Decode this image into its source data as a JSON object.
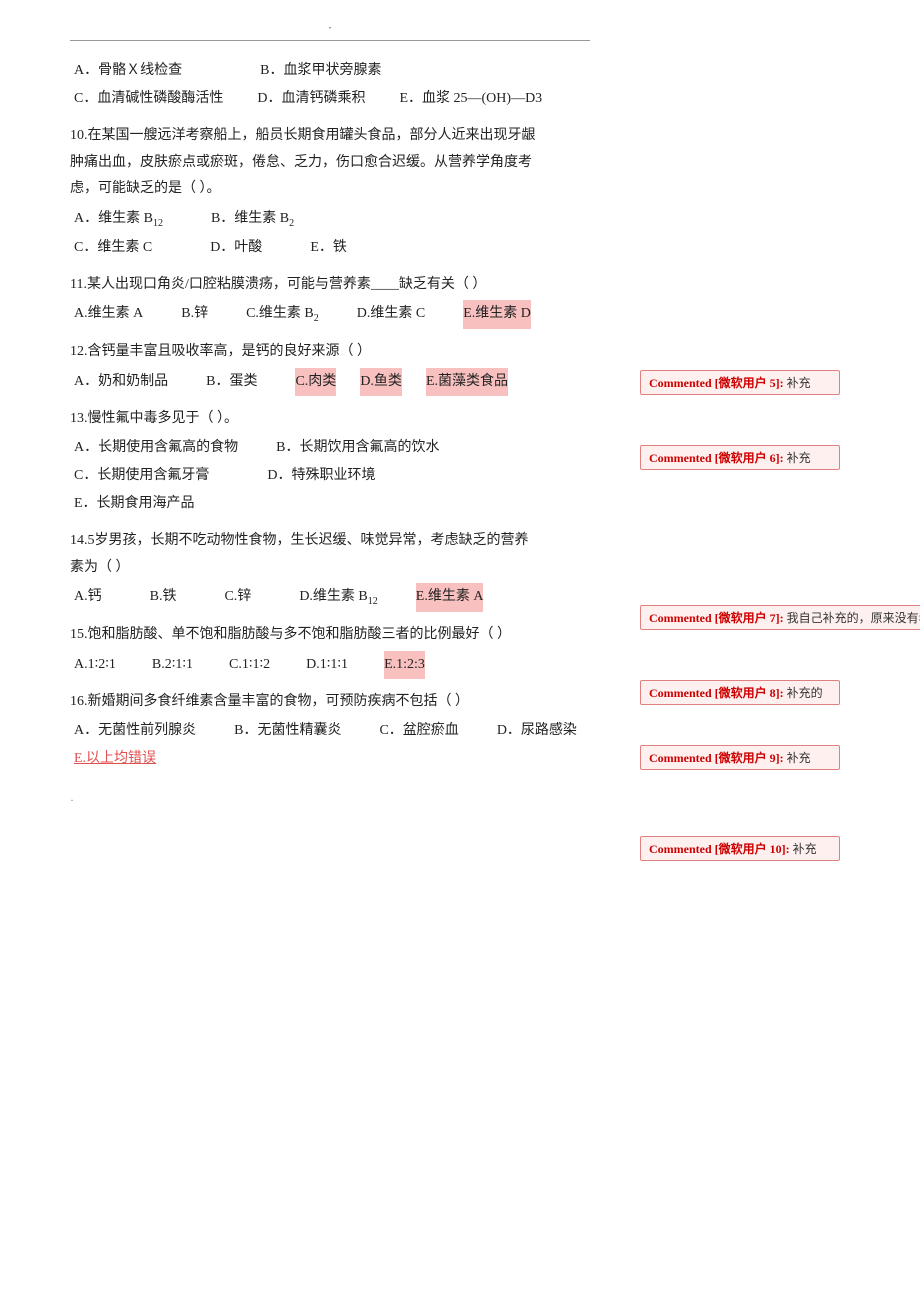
{
  "top": {
    "line_text": "·"
  },
  "questions": [
    {
      "id": "q_options_top",
      "options": [
        {
          "label": "A．骨骼Ｘ线检查",
          "highlight": false
        },
        {
          "label": "B．血浆甲状旁腺素",
          "highlight": false
        },
        {
          "label": "C．血清碱性磷酸酶活性",
          "highlight": false
        },
        {
          "label": "D．血清钙磷乘积",
          "highlight": false
        },
        {
          "label": "E．血浆 25—(OH)—D3",
          "highlight": false
        }
      ]
    },
    {
      "id": "q10",
      "num": "10",
      "text": "10.在某国一艘远洋考察船上，船员长期食用罐头食品，部分人近来出现牙龈肿痛出血，皮肤瘀点或瘀斑，倦怠、乏力，伤口愈合迟缓。从营养学角度考虑，可能缺乏的是（    ）。",
      "options": [
        {
          "label": "A．维生素 B₁₂",
          "highlight": false
        },
        {
          "label": "B．维生素 B₂",
          "highlight": false
        },
        {
          "label": "C．维生素 C",
          "highlight": false
        },
        {
          "label": "D．叶酸",
          "highlight": false
        },
        {
          "label": "E．铁",
          "highlight": false
        }
      ]
    },
    {
      "id": "q11",
      "num": "11",
      "text": "11.某人出现口角炎/口腔粘膜溃疡，可能与营养素____缺乏有关（  ）",
      "options": [
        {
          "label": "A.维生素 A",
          "highlight": false
        },
        {
          "label": "B.锌",
          "highlight": false
        },
        {
          "label": "C.维生素 B₂",
          "highlight": false
        },
        {
          "label": "D.维生素 C",
          "highlight": false
        },
        {
          "label": "E.维生素 D",
          "highlight": true
        }
      ],
      "comment_index": 0
    },
    {
      "id": "q12",
      "num": "12",
      "text": "12.含钙量丰富且吸收率高，是钙的良好来源（    ）",
      "options": [
        {
          "label": "A．奶和奶制品",
          "highlight": false
        },
        {
          "label": "B．蛋类",
          "highlight": false
        },
        {
          "label": "C.肉类",
          "highlight": true
        },
        {
          "label": "D.鱼类",
          "highlight": true
        },
        {
          "label": "E.菌藻类食品",
          "highlight": true
        }
      ],
      "comment_index": 1
    },
    {
      "id": "q13",
      "num": "13",
      "text": "13.慢性氟中毒多见于（    ）。",
      "options": [
        {
          "label": "A．长期使用含氟高的食物",
          "highlight": false
        },
        {
          "label": "B．长期饮用含氟高的饮水",
          "highlight": false
        },
        {
          "label": "C．长期使用含氟牙膏",
          "highlight": false
        },
        {
          "label": "D．特殊职业环境",
          "highlight": false
        },
        {
          "label": "E．长期食用海产品",
          "highlight": false
        }
      ]
    },
    {
      "id": "q14",
      "num": "14",
      "text": "14.5岁男孩，长期不吃动物性食物，生长迟缓、味觉异常，考虑缺乏的营养素为（  ）",
      "options": [
        {
          "label": "A.钙",
          "highlight": false
        },
        {
          "label": "B.铁",
          "highlight": false
        },
        {
          "label": "C.锌",
          "highlight": false
        },
        {
          "label": "D.维生素 B₁₂",
          "highlight": false
        },
        {
          "label": "E.维生素 A",
          "highlight": true
        }
      ],
      "comment_index": 2
    },
    {
      "id": "q15",
      "num": "15",
      "text": "15.饱和脂肪酸、单不饱和脂肪酸与多不饱和脂肪酸三者的比例最好（  ）",
      "options": [
        {
          "label": "A.1∶2∶1",
          "highlight": false
        },
        {
          "label": "B.2∶1∶1",
          "highlight": false
        },
        {
          "label": "C.1∶1∶2",
          "highlight": false
        },
        {
          "label": "D.1∶1∶1",
          "highlight": false
        },
        {
          "label": "E.1:2:3",
          "highlight": true
        }
      ],
      "comment_index": 3
    },
    {
      "id": "q16",
      "num": "16",
      "text": "16.新婚期间多食纤维素含量丰富的食物，可预防疾病不包括（    ）",
      "options": [
        {
          "label": "A．无菌性前列腺炎",
          "highlight": false
        },
        {
          "label": "B．无菌性精囊炎",
          "highlight": false
        },
        {
          "label": "C．盆腔瘀血",
          "highlight": false
        },
        {
          "label": "D．尿路感染",
          "highlight": false
        },
        {
          "label": "E.以上均错误",
          "highlight": true,
          "pink_text": true
        }
      ],
      "comment_index": 4
    }
  ],
  "comments": [
    {
      "label": "Commented [微软用户 5]:",
      "text": "补充"
    },
    {
      "label": "Commented [微软用户 6]:",
      "text": "补充"
    },
    {
      "label": "Commented [微软用户 7]:",
      "text": "我自己补充的，原来没有年龄"
    },
    {
      "label": "Commented [微软用户 8]:",
      "text": "补充的"
    },
    {
      "label": "Commented [微软用户 9]:",
      "text": "补充"
    },
    {
      "label": "Commented [微软用户 10]:",
      "text": "补充"
    }
  ],
  "bottom_dot": "·"
}
